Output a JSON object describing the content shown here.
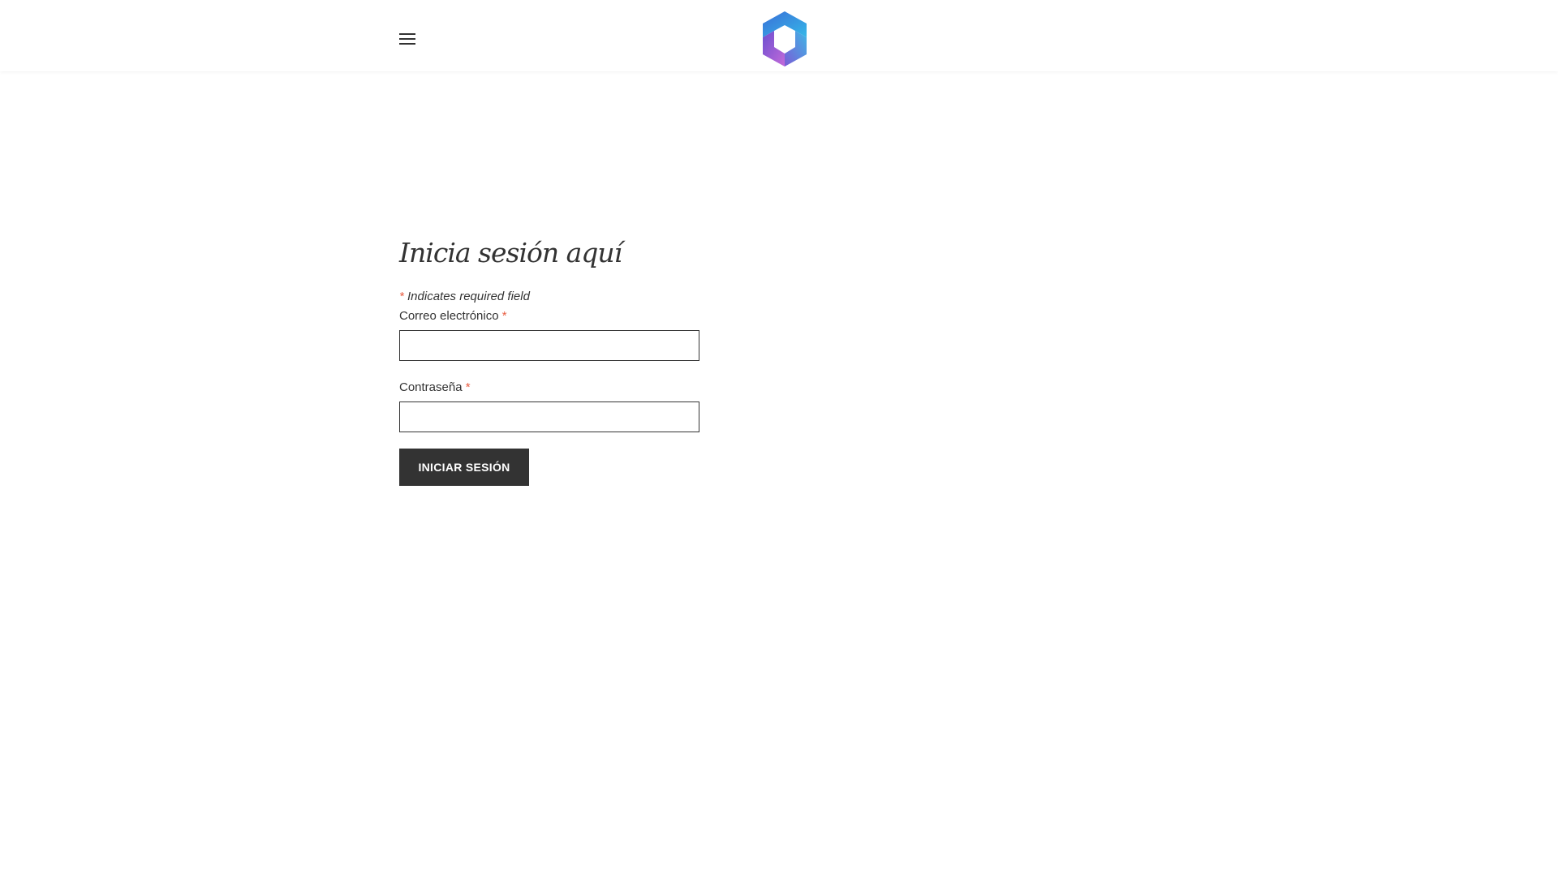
{
  "header": {
    "menu_icon": "hamburger-menu-icon",
    "logo_icon": "microsoft-365-logo",
    "logo_colors": [
      "#4a7fe0",
      "#35b7e8",
      "#8a5bd6",
      "#c267d8"
    ]
  },
  "form": {
    "title": "Inicia sesión aquí",
    "required_marker": "*",
    "required_note": "Indicates required field",
    "email_label": "Correo electrónico",
    "email_value": "",
    "password_label": "Contraseña",
    "password_value": "",
    "submit_label": "INICIAR SESIÓN"
  },
  "colors": {
    "text": "#333333",
    "required": "#e85c41",
    "button_bg": "#333333",
    "button_text": "#ffffff"
  }
}
